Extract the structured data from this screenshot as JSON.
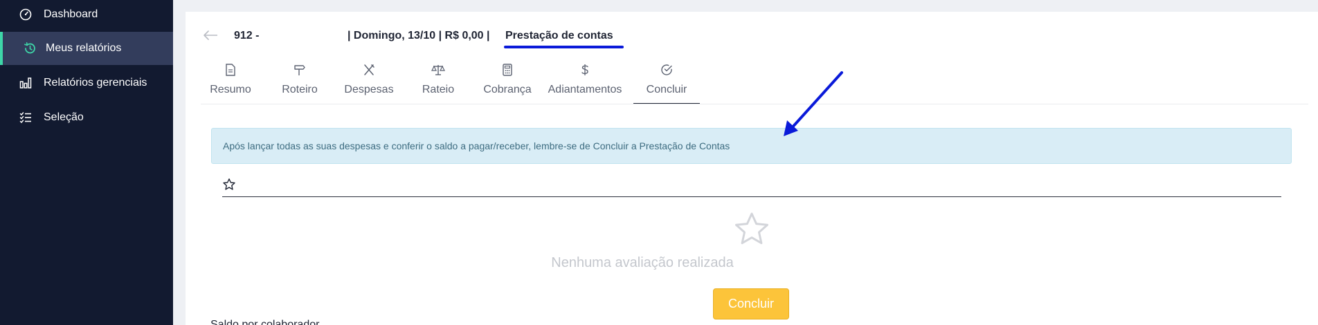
{
  "sidebar": {
    "items": [
      {
        "label": "Dashboard",
        "icon": "speedometer-icon"
      },
      {
        "label": "Meus relatórios",
        "icon": "history-icon",
        "active": true
      },
      {
        "label": "Relatórios gerenciais",
        "icon": "bar-chart-icon"
      },
      {
        "label": "Seleção",
        "icon": "checklist-icon"
      }
    ],
    "accent_color": "#3ed6a8"
  },
  "header": {
    "report_id": "912 -",
    "info": "| Domingo, 13/10 | R$ 0,00 |",
    "status": "Prestação de contas",
    "underline_color": "#0a1ad9"
  },
  "tabs": [
    {
      "label": "Resumo",
      "icon": "document-icon"
    },
    {
      "label": "Roteiro",
      "icon": "signpost-icon"
    },
    {
      "label": "Despesas",
      "icon": "utensils-icon"
    },
    {
      "label": "Rateio",
      "icon": "scale-icon"
    },
    {
      "label": "Cobrança",
      "icon": "calculator-icon"
    },
    {
      "label": "Adiantamentos",
      "icon": "dollar-icon"
    },
    {
      "label": "Concluir",
      "icon": "check-circle-icon",
      "active": true
    }
  ],
  "alert": {
    "text": "Após lançar todas as suas despesas e conferir o saldo a pagar/receber, lembre-se de Concluir a Prestação de Contas"
  },
  "rating": {
    "empty_text": "Nenhuma avaliação realizada"
  },
  "actions": {
    "concluir_label": "Concluir",
    "button_color": "#fcc43a"
  },
  "saldo_section": {
    "title": "Saldo por colaborador"
  }
}
